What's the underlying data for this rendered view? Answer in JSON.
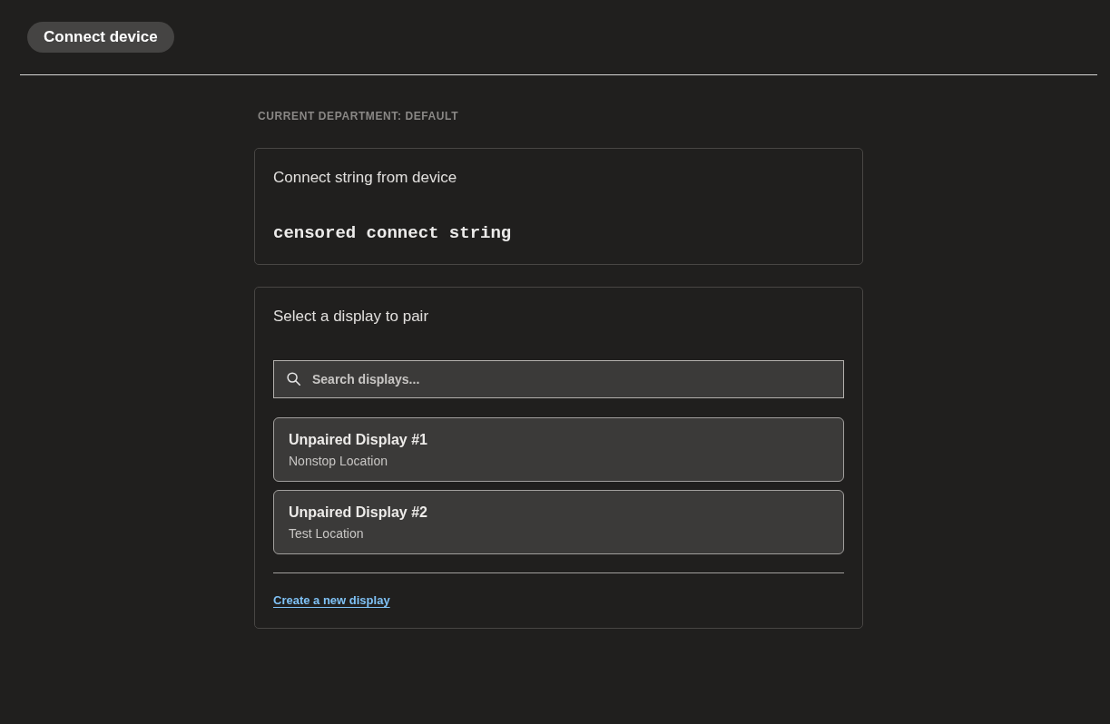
{
  "header": {
    "title": "Connect device"
  },
  "department_label": "CURRENT DEPARTMENT: DEFAULT",
  "connect_card": {
    "title": "Connect string from device",
    "connect_string": "censored connect string"
  },
  "pair_card": {
    "title": "Select a display to pair",
    "search": {
      "placeholder": "Search displays..."
    },
    "displays": [
      {
        "name": "Unpaired Display #1",
        "location": "Nonstop Location"
      },
      {
        "name": "Unpaired Display #2",
        "location": "Test Location"
      }
    ],
    "create_link": "Create a new display"
  }
}
